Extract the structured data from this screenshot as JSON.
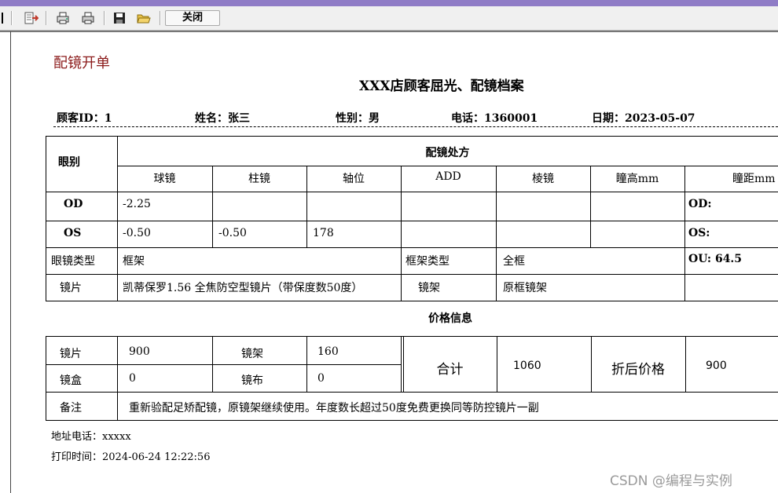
{
  "toolbar": {
    "close_label": "关闭"
  },
  "report": {
    "small_title": "配镜开单",
    "main_title": "XXX店顾客屈光、配镜档案",
    "info": {
      "customer_id": "顾客ID：1",
      "name": "姓名：张三",
      "gender": "性别：男",
      "phone": "电话：1360001",
      "date": "日期：2023-05-07"
    },
    "prescription": {
      "eye_label": "眼别",
      "section_title": "配镜处方",
      "headers": [
        "球镜",
        "柱镜",
        "轴位",
        "ADD",
        "棱镜",
        "瞳高mm",
        "瞳距mm"
      ],
      "od": {
        "label": "OD",
        "sphere": "-2.25",
        "cyl": "",
        "axis": "",
        "add": "",
        "prism": "",
        "height": "",
        "pd": "OD:"
      },
      "os": {
        "label": "OS",
        "sphere": "-0.50",
        "cyl": "-0.50",
        "axis": "178",
        "add": "",
        "prism": "",
        "height": "",
        "pd": "OS:"
      },
      "glasses_type_label": "眼镜类型",
      "glasses_type": "框架",
      "frame_type_label": "框架类型",
      "frame_type": "全框",
      "ou": "OU:  64.5",
      "lens_label": "镜片",
      "lens": "凯蒂保罗1.56 全焦防空型镜片（带保度数50度）",
      "frame_label": "镜架",
      "frame": "原框镜架"
    },
    "price": {
      "section_title": "价格信息",
      "lens_label": "镜片",
      "lens": "900",
      "frame_label": "镜架",
      "frame": "160",
      "case_label": "镜盒",
      "case": "0",
      "cloth_label": "镜布",
      "cloth": "0",
      "total_label": "合计",
      "total": "1060",
      "discount_label": "折后价格",
      "discount": "900",
      "remark_label": "备注",
      "remark": "重新验配足矫配镜，原镜架继续使用。年度数长超过50度免费更换同等防控镜片一副"
    },
    "footer": {
      "address": "地址电话：xxxxx",
      "print_time": "打印时间：2024-06-24 12:22:56"
    }
  },
  "watermark": "CSDN @编程与实例"
}
